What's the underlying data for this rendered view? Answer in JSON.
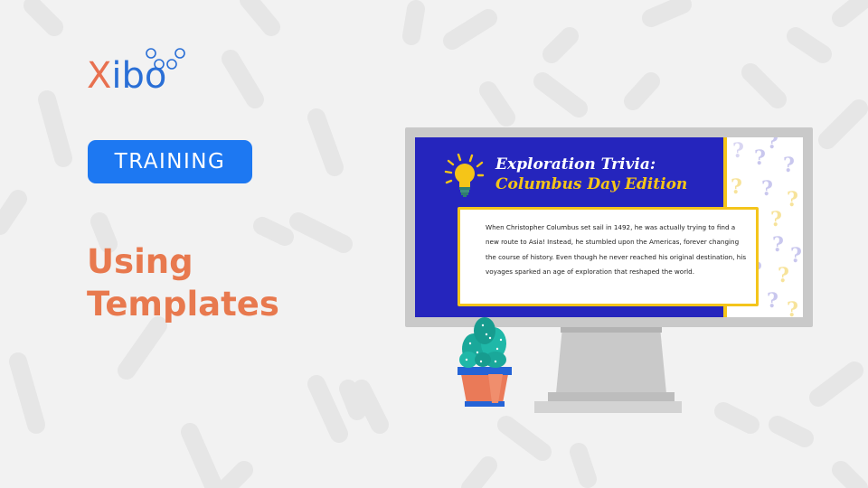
{
  "brand": {
    "logo_x": "X",
    "logo_rest": "ibo"
  },
  "badge": {
    "label": "TRAINING"
  },
  "title": {
    "line1": "Using",
    "line2": "Templates"
  },
  "screen": {
    "heading_line1": "Exploration Trivia:",
    "heading_line2": "Columbus Day Edition",
    "body": "When Christopher Columbus set sail in 1492, he was actually trying to find a new route to Asia! Instead, he stumbled upon the Americas, forever changing the course of history. Even though he never reached his original destination, his voyages sparked an age of exploration that reshaped the world."
  },
  "icons": {
    "logo_dots": "bubble-dots-icon",
    "bulb": "light-bulb-icon",
    "plant": "cactus-plant-icon",
    "question_pattern": "question-mark-icon"
  },
  "colors": {
    "accent_orange": "#e8794e",
    "accent_blue": "#1d78f2",
    "screen_blue": "#2525bd",
    "trivia_yellow": "#f5c518",
    "background": "#f2f2f2"
  }
}
